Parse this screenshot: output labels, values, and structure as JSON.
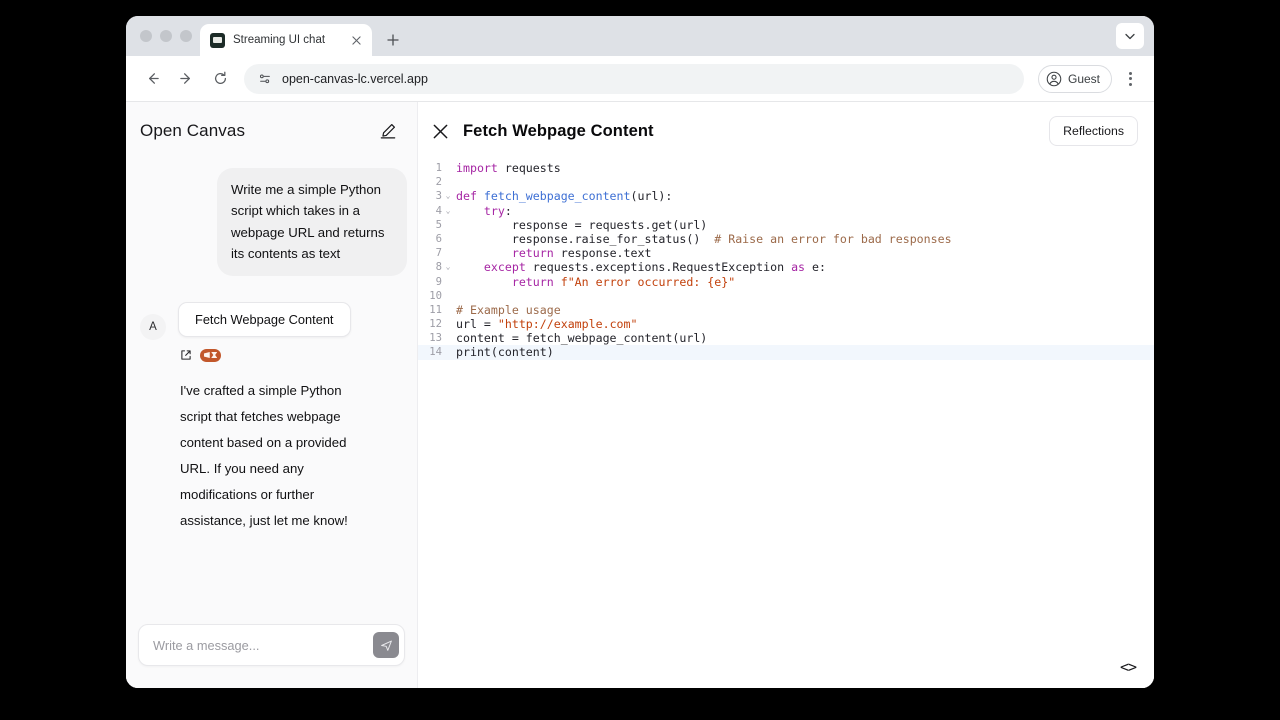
{
  "browser": {
    "tab": {
      "title": "Streaming UI chat",
      "favicon": "langchain-favicon",
      "close_icon": "close-icon"
    },
    "new_tab_icon": "plus-icon",
    "tab_list_icon": "chevron-down-icon",
    "back_icon": "arrow-left-icon",
    "forward_icon": "arrow-right-icon",
    "reload_icon": "reload-icon",
    "site_info_icon": "site-settings-icon",
    "url": "open-canvas-lc.vercel.app",
    "profile_label": "Guest",
    "profile_icon": "account-circle-icon",
    "menu_icon": "kebab-menu-icon"
  },
  "sidebar": {
    "app_title": "Open Canvas",
    "new_chat_icon": "compose-icon",
    "user_message": "Write me a simple Python script which takes in a webpage URL and returns its contents as text",
    "assistant": {
      "avatar_initial": "A",
      "artifact_button_label": "Fetch Webpage Content",
      "external_link_icon": "external-link-icon",
      "badge_icon": "langsmith-badge-icon",
      "text": "I've crafted a simple Python script that fetches webpage content based on a provided URL. If you need any modifications or further assistance, just let me know!"
    },
    "composer": {
      "placeholder": "Write a message...",
      "value": "",
      "send_icon": "send-icon"
    }
  },
  "editor": {
    "close_icon": "close-icon",
    "artifact_title": "Fetch Webpage Content",
    "reflections_label": "Reflections",
    "code_toggle_icon": "code-brackets-icon",
    "active_line": 14,
    "fold_lines": [
      3,
      4,
      8
    ],
    "lines": [
      {
        "n": 1,
        "tokens": [
          {
            "t": "import",
            "c": "kw"
          },
          {
            "t": " requests",
            "c": "def"
          }
        ]
      },
      {
        "n": 2,
        "tokens": []
      },
      {
        "n": 3,
        "tokens": [
          {
            "t": "def ",
            "c": "kw"
          },
          {
            "t": "fetch_webpage_content",
            "c": "fn"
          },
          {
            "t": "(url):",
            "c": "def"
          }
        ]
      },
      {
        "n": 4,
        "tokens": [
          {
            "t": "    ",
            "c": "def"
          },
          {
            "t": "try",
            "c": "kw"
          },
          {
            "t": ":",
            "c": "def"
          }
        ]
      },
      {
        "n": 5,
        "tokens": [
          {
            "t": "        response = requests.get(url)",
            "c": "def"
          }
        ]
      },
      {
        "n": 6,
        "tokens": [
          {
            "t": "        response.raise_for_status()  ",
            "c": "def"
          },
          {
            "t": "# Raise an error for bad responses",
            "c": "com"
          }
        ]
      },
      {
        "n": 7,
        "tokens": [
          {
            "t": "        ",
            "c": "def"
          },
          {
            "t": "return",
            "c": "kw"
          },
          {
            "t": " response.text",
            "c": "def"
          }
        ]
      },
      {
        "n": 8,
        "tokens": [
          {
            "t": "    ",
            "c": "def"
          },
          {
            "t": "except",
            "c": "kw"
          },
          {
            "t": " requests.exceptions.RequestException ",
            "c": "def"
          },
          {
            "t": "as",
            "c": "kw"
          },
          {
            "t": " e:",
            "c": "def"
          }
        ]
      },
      {
        "n": 9,
        "tokens": [
          {
            "t": "        ",
            "c": "def"
          },
          {
            "t": "return",
            "c": "kw"
          },
          {
            "t": " ",
            "c": "def"
          },
          {
            "t": "f\"An error occurred: {e}\"",
            "c": "str"
          }
        ]
      },
      {
        "n": 10,
        "tokens": []
      },
      {
        "n": 11,
        "tokens": [
          {
            "t": "# Example usage",
            "c": "com"
          }
        ]
      },
      {
        "n": 12,
        "tokens": [
          {
            "t": "url = ",
            "c": "def"
          },
          {
            "t": "\"http://example.com\"",
            "c": "str"
          }
        ]
      },
      {
        "n": 13,
        "tokens": [
          {
            "t": "content = fetch_webpage_content(url)",
            "c": "def"
          }
        ]
      },
      {
        "n": 14,
        "tokens": [
          {
            "t": "print(content)",
            "c": "def"
          }
        ]
      }
    ]
  },
  "colors": {
    "keyword": "#a626a4",
    "function": "#3d6fd4",
    "string": "#c2410c",
    "comment": "#9c6a4a",
    "badge": "#c2572b",
    "active_line": "#f2f7fd"
  }
}
